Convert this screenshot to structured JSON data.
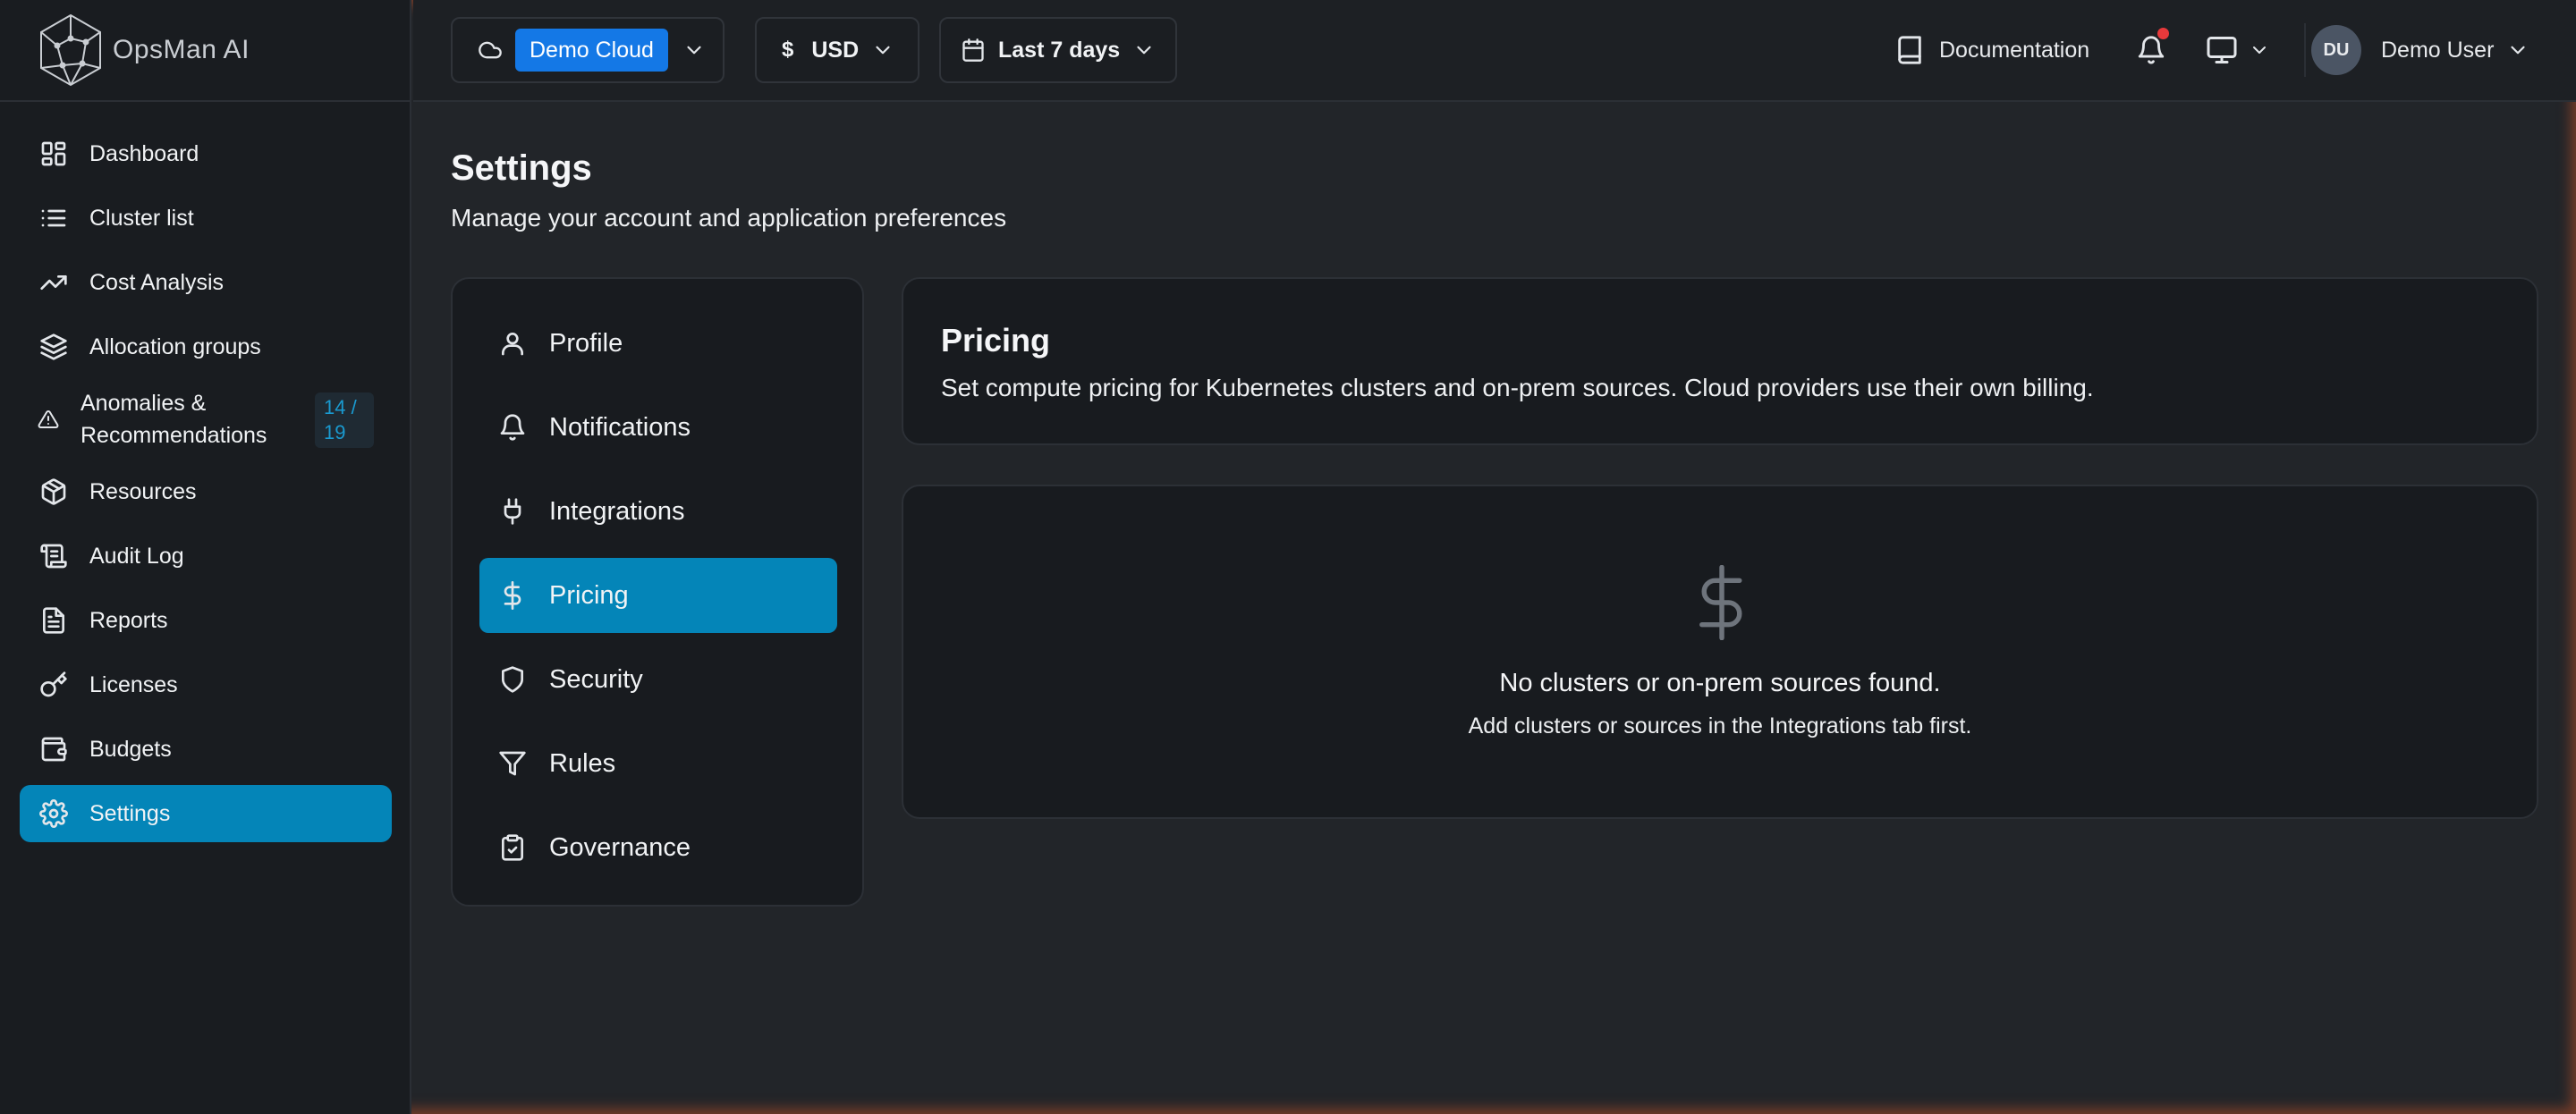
{
  "brand": {
    "name": "OpsMan AI"
  },
  "topbar": {
    "cloud_selector": {
      "value": "Demo Cloud",
      "icon": "cloud-icon"
    },
    "currency_selector": {
      "symbol": "$",
      "value": "USD"
    },
    "date_range": {
      "value": "Last 7 days",
      "icon": "calendar-icon"
    },
    "documentation_label": "Documentation",
    "notifications": {
      "has_unread": true
    },
    "user": {
      "initials": "DU",
      "name": "Demo User"
    }
  },
  "sidebar": {
    "items": [
      {
        "label": "Dashboard",
        "icon": "dashboard-icon",
        "active": false
      },
      {
        "label": "Cluster list",
        "icon": "list-icon",
        "active": false
      },
      {
        "label": "Cost Analysis",
        "icon": "trending-up-icon",
        "active": false
      },
      {
        "label": "Allocation groups",
        "icon": "layers-icon",
        "active": false
      },
      {
        "label": "Anomalies & Recommendations",
        "icon": "warning-icon",
        "badge": "14 / 19",
        "active": false
      },
      {
        "label": "Resources",
        "icon": "package-icon",
        "active": false
      },
      {
        "label": "Audit Log",
        "icon": "scroll-icon",
        "active": false
      },
      {
        "label": "Reports",
        "icon": "file-text-icon",
        "active": false
      },
      {
        "label": "Licenses",
        "icon": "key-icon",
        "active": false
      },
      {
        "label": "Budgets",
        "icon": "wallet-icon",
        "active": false
      },
      {
        "label": "Settings",
        "icon": "gear-icon",
        "active": true
      }
    ]
  },
  "page": {
    "title": "Settings",
    "subtitle": "Manage your account and application preferences"
  },
  "settings_menu": {
    "items": [
      {
        "label": "Profile",
        "icon": "user-icon",
        "active": false
      },
      {
        "label": "Notifications",
        "icon": "bell-icon",
        "active": false
      },
      {
        "label": "Integrations",
        "icon": "plug-icon",
        "active": false
      },
      {
        "label": "Pricing",
        "icon": "dollar-icon",
        "active": true
      },
      {
        "label": "Security",
        "icon": "shield-icon",
        "active": false
      },
      {
        "label": "Rules",
        "icon": "filter-icon",
        "active": false
      },
      {
        "label": "Governance",
        "icon": "clipboard-check-icon",
        "active": false
      }
    ]
  },
  "pricing": {
    "title": "Pricing",
    "description": "Set compute pricing for Kubernetes clusters and on-prem sources. Cloud providers use their own billing.",
    "empty_state": {
      "title": "No clusters or on-prem sources found.",
      "subtitle": "Add clusters or sources in the Integrations tab first."
    }
  },
  "colors": {
    "accent": "#0485b8",
    "chip": "#1478e6",
    "notification_dot": "#e8393b"
  }
}
